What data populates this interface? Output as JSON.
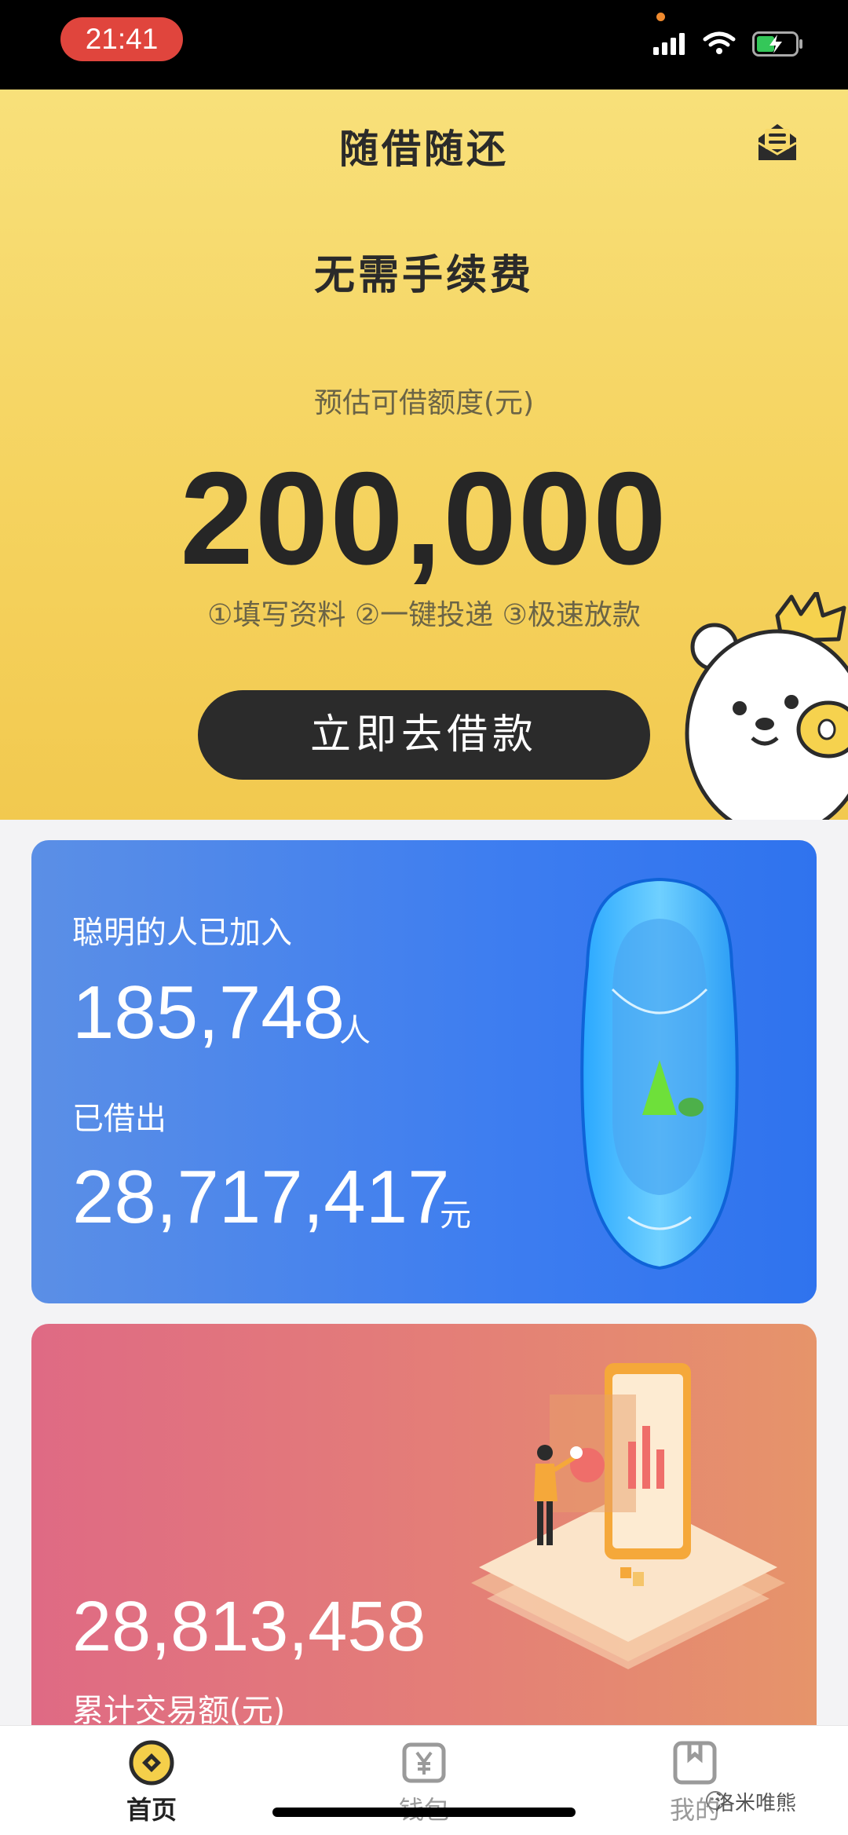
{
  "status_bar": {
    "time": "21:41"
  },
  "header": {
    "title": "随借随还"
  },
  "hero": {
    "headline": "无需手续费",
    "limit_label": "预估可借额度(元)",
    "limit_amount": "200,000",
    "steps": "①填写资料 ②一键投递 ③极速放款",
    "cta_label": "立即去借款"
  },
  "stats": {
    "joined_label": "聪明的人已加入",
    "joined_value": "185,748",
    "joined_unit": "人",
    "lent_label": "已借出",
    "lent_value": "28,717,417",
    "lent_unit": "元"
  },
  "volume": {
    "value": "28,813,458",
    "label": "累计交易额(元)"
  },
  "tabs": [
    {
      "label": "首页",
      "icon": "home-coin-icon",
      "active": true
    },
    {
      "label": "钱包",
      "icon": "wallet-yen-icon",
      "active": false
    },
    {
      "label": "我的",
      "icon": "profile-icon",
      "active": false
    }
  ],
  "watermark": "洛米唯熊",
  "colors": {
    "hero_yellow": "#f5d35f",
    "blue_card": "#3d7df0",
    "pink_card": "#e47f77",
    "cta_dark": "#2b2b2b"
  }
}
